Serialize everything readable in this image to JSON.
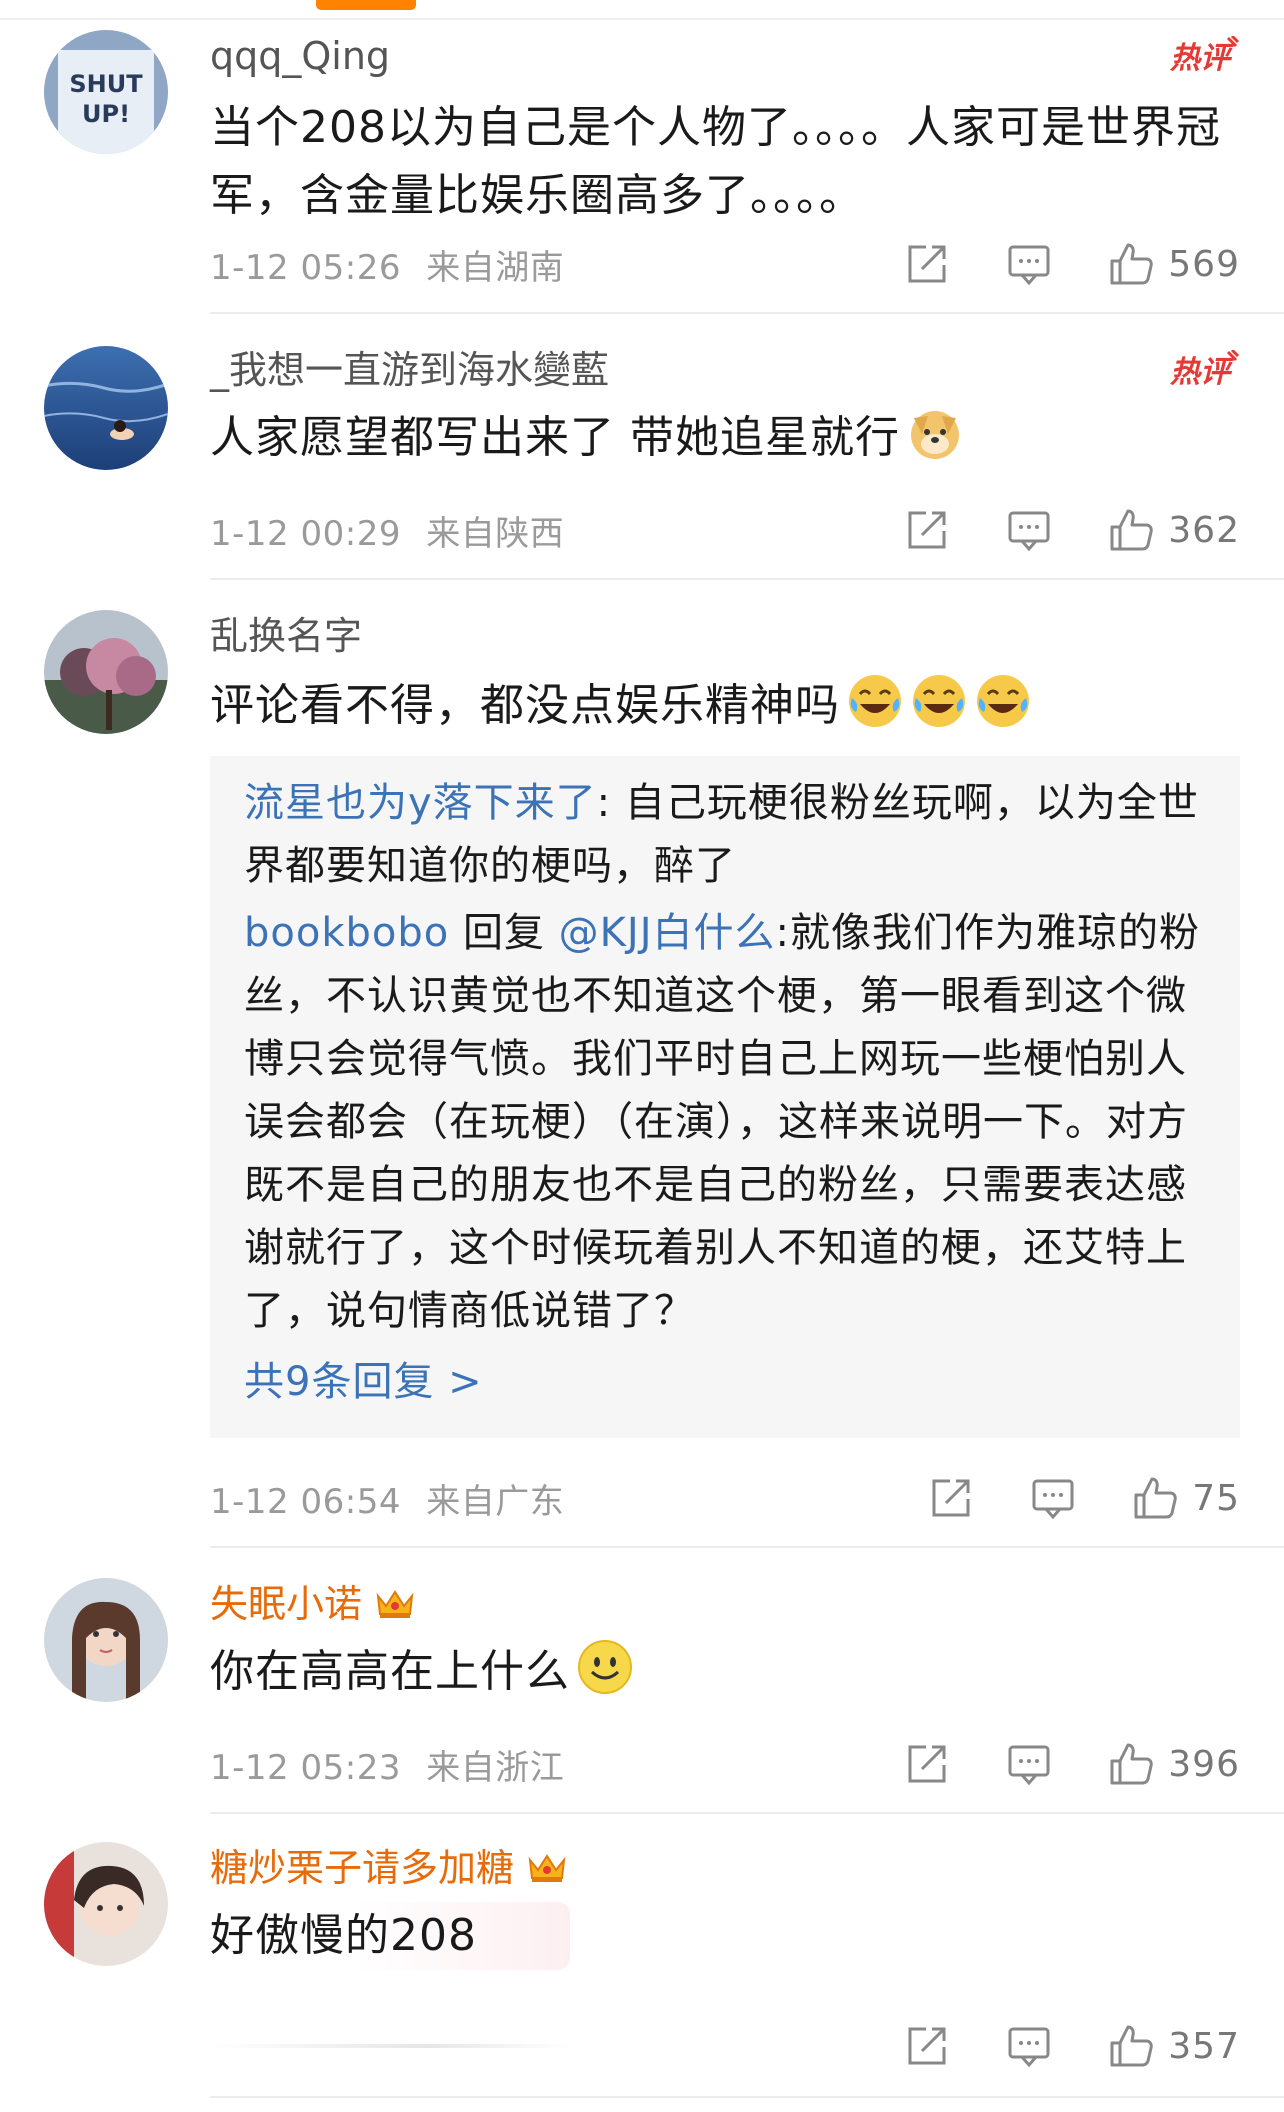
{
  "colors": {
    "accent": "#ff8200",
    "link": "#3b73b6",
    "vip_name": "#e86b0a",
    "hot_badge": "#e53935"
  },
  "comments": [
    {
      "username": "qqq_Qing",
      "text": "当个208以为自己是个人物了。。。。人家可是世界冠军，含金量比娱乐圈高多了。。。。",
      "time": "1-12 05:26",
      "location": "来自湖南",
      "likes": "569",
      "badge": "热评"
    },
    {
      "username": "_我想一直游到海水變藍",
      "text": "人家愿望都写出来了 带她追星就行",
      "time": "1-12 00:29",
      "location": "来自陕西",
      "likes": "362",
      "badge": "热评",
      "emoji": "doge-emoji"
    },
    {
      "username": "乱换名字",
      "text": "评论看不得，都没点娱乐精神吗",
      "time": "1-12 06:54",
      "location": "来自广东",
      "likes": "75",
      "emoji": "laugh-cry-emoji",
      "replies": [
        {
          "author": "流星也为y落下来了",
          "text": ": 自己玩梗很粉丝玩啊，以为全世界都要知道你的梗吗，醉了"
        },
        {
          "author": "bookbobo",
          "reply_word": " 回复 ",
          "target": "@KJJ白什么",
          "text": ":就像我们作为雅琼的粉丝，不认识黄觉也不知道这个梗，第一眼看到这个微博只会觉得气愤。我们平时自己上网玩一些梗怕别人误会都会（在玩梗）（在演），这样来说明一下。对方既不是自己的朋友也不是自己的粉丝，只需要表达感谢就行了，这个时候玩着别人不知道的梗，还艾特上了，说句情商低说错了？"
        }
      ],
      "more_replies": "共9条回复 >"
    },
    {
      "username": "失眠小诺",
      "text": "你在高高在上什么",
      "time": "1-12 05:23",
      "location": "来自浙江",
      "likes": "396",
      "emoji": "smile-emoji"
    },
    {
      "username": "糖炒栗子请多加糖",
      "text": "好傲慢的208",
      "likes": "357"
    }
  ]
}
